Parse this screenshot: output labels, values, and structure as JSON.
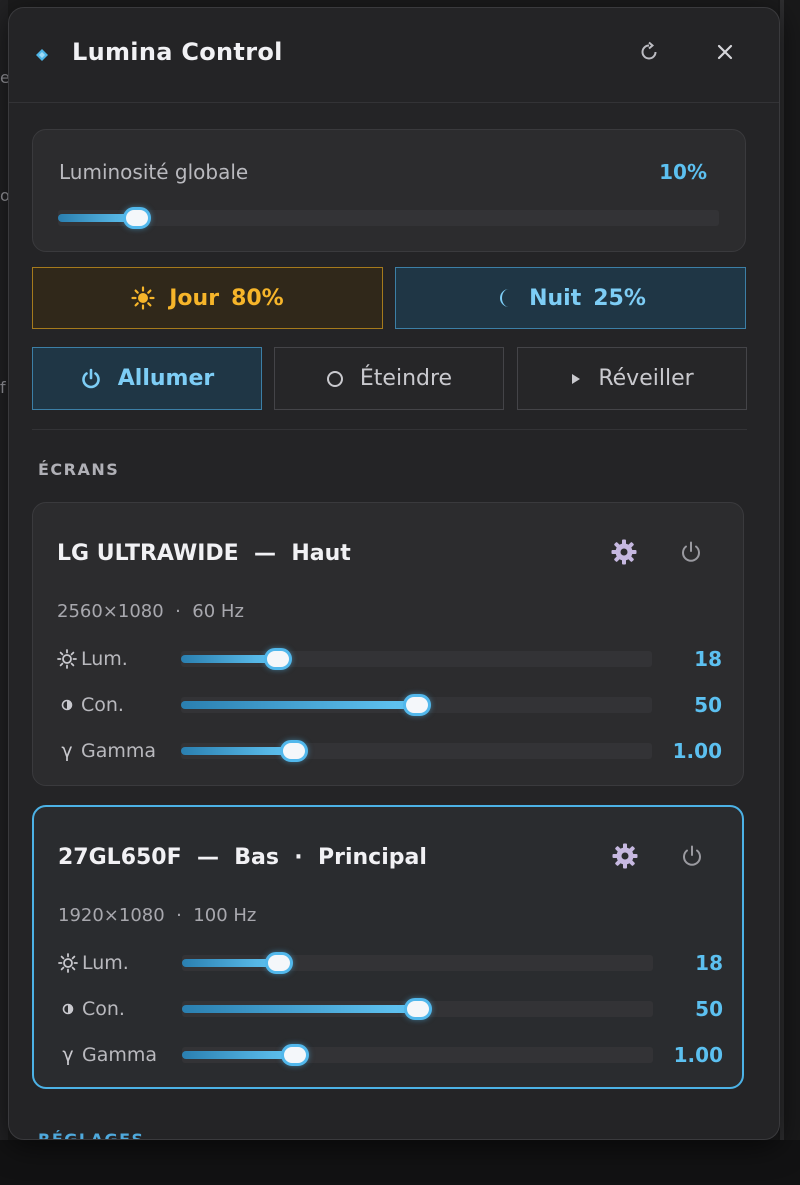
{
  "window": {
    "title": "Lumina Control",
    "icons": {
      "app": "diamond-icon",
      "refresh": "refresh-icon",
      "close": "close-icon"
    }
  },
  "global_brightness": {
    "label": "Luminosité globale",
    "value_text": "10%",
    "value": 10
  },
  "presets": {
    "day": {
      "label": "Jour",
      "value": "80%",
      "icon": "sun-icon"
    },
    "night": {
      "label": "Nuit",
      "value": "25%",
      "icon": "moon-icon"
    }
  },
  "actions": {
    "on": {
      "label": "Allumer",
      "icon": "power-icon"
    },
    "off": {
      "label": "Éteindre",
      "icon": "circle-icon"
    },
    "wake": {
      "label": "Réveiller",
      "icon": "play-icon"
    }
  },
  "sections": {
    "screens": "ÉCRANS",
    "settings": "RÉGLAGES"
  },
  "screens": [
    {
      "title": "LG ULTRAWIDE  —  Haut",
      "spec": "2560×1080  ·  60 Hz",
      "controls": [
        {
          "icon": "sun-icon",
          "label": "Lum.",
          "value_text": "18",
          "fraction": 0.205
        },
        {
          "icon": "contrast-icon",
          "label": "Con.",
          "value_text": "50",
          "fraction": 0.5
        },
        {
          "icon": "gamma-icon",
          "label": "Gamma",
          "value_text": "1.00",
          "fraction": 0.24
        }
      ]
    },
    {
      "title": "27GL650F  —  Bas  ·  Principal",
      "spec": "1920×1080  ·  100 Hz",
      "controls": [
        {
          "icon": "sun-icon",
          "label": "Lum.",
          "value_text": "18",
          "fraction": 0.205
        },
        {
          "icon": "contrast-icon",
          "label": "Con.",
          "value_text": "50",
          "fraction": 0.5
        },
        {
          "icon": "gamma-icon",
          "label": "Gamma",
          "value_text": "1.00",
          "fraction": 0.24
        }
      ]
    }
  ],
  "colors": {
    "accent": "#5cc0f0",
    "day": "#f6b52a",
    "night": "#7dcdf5",
    "gear": "#c6b8e0"
  }
}
